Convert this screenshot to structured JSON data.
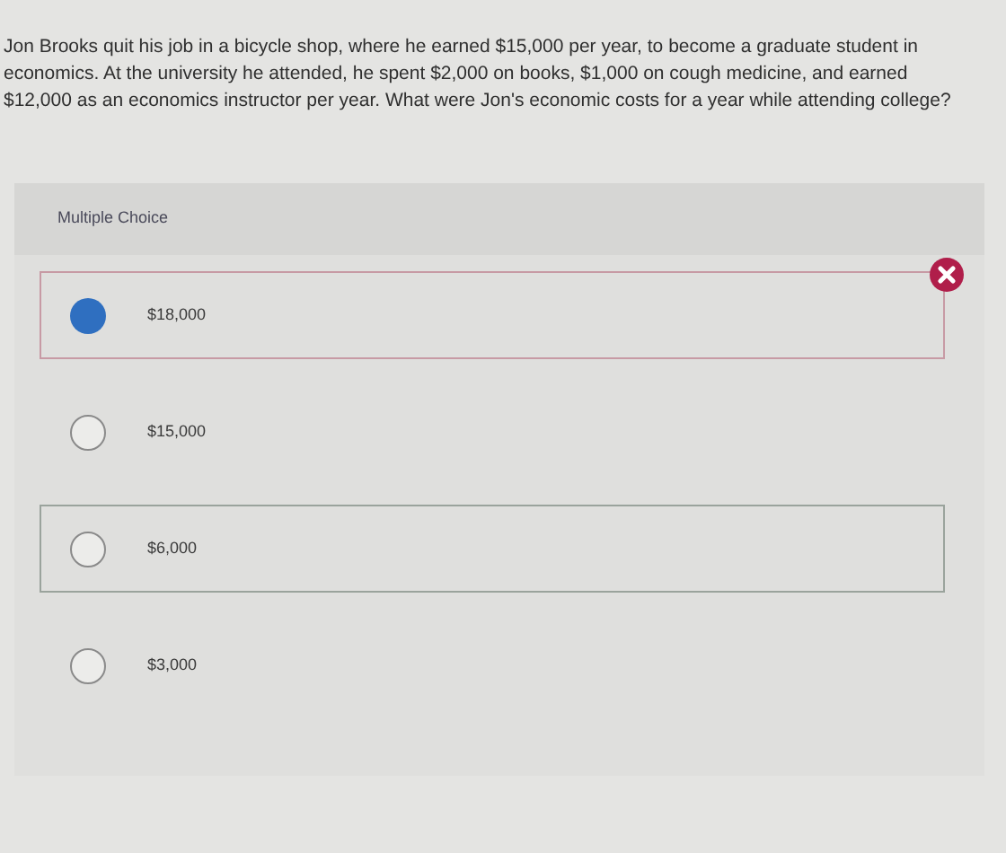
{
  "question": "Jon Brooks quit his job in a bicycle shop, where he earned $15,000 per year, to become a graduate student in economics. At the university he attended, he spent $2,000 on books, $1,000 on cough medicine, and earned $12,000 as an economics instructor per year. What were Jon's economic costs for a year while attending college?",
  "section_label": "Multiple Choice",
  "options": [
    {
      "label": "$18,000",
      "selected": true,
      "kind": "incorrect"
    },
    {
      "label": "$15,000",
      "selected": false,
      "kind": "plain"
    },
    {
      "label": "$6,000",
      "selected": false,
      "kind": "correct"
    },
    {
      "label": "$3,000",
      "selected": false,
      "kind": "plain"
    }
  ]
}
